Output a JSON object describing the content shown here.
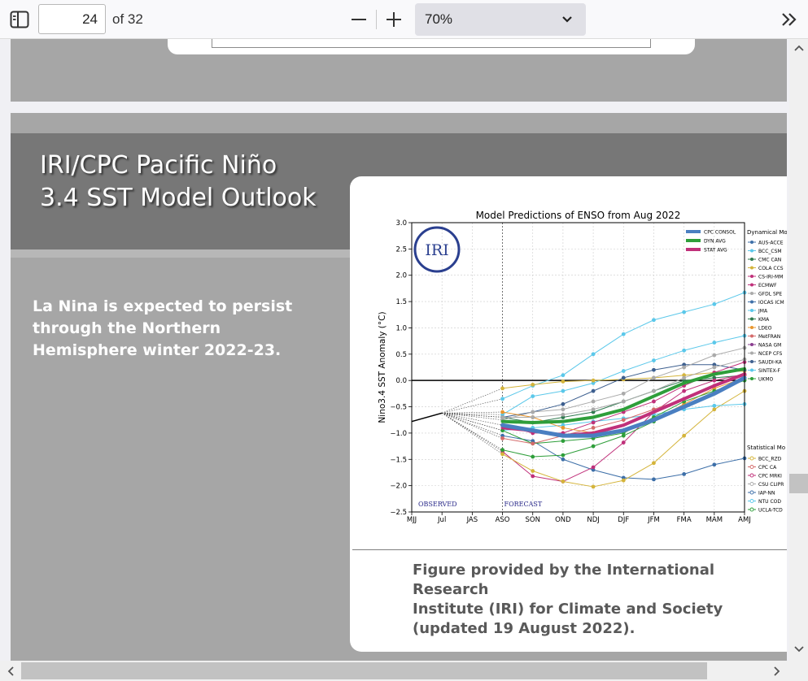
{
  "toolbar": {
    "page_number": "24",
    "page_count_label": "of 32",
    "zoom_value": "70%"
  },
  "slide": {
    "title_line1": "IRI/CPC Pacific Niño",
    "title_line2": "3.4 SST Model Outlook",
    "body_text": "La Nina is expected to persist through the Northern Hemisphere winter 2022-23.",
    "caption_line1": "Figure provided by the International Research",
    "caption_line2": "Institute (IRI) for Climate and Society",
    "caption_line3": "(updated 19 August 2022)."
  },
  "colors": {
    "cpc_consol": "#4a7fc1",
    "dyn_avg": "#2e9e3a",
    "stat_avg": "#c0307a"
  },
  "chart_data": {
    "type": "line",
    "title": "Model Predictions of ENSO from Aug 2022",
    "ylabel": "Nino3.4 SST Anomaly (°C)",
    "xlabel": "",
    "categories": [
      "MJJ",
      "Jul",
      "JAS",
      "ASO",
      "SON",
      "OND",
      "NDJ",
      "DJF",
      "JFM",
      "FMA",
      "MAM",
      "AMJ"
    ],
    "ylim": [
      -2.5,
      3.0
    ],
    "yticks": [
      "−2.5",
      "−2.0",
      "−1.5",
      "−1.0",
      "−0.5",
      "0.0",
      "0.5",
      "1.0",
      "1.5",
      "2.0",
      "2.5",
      "3.0"
    ],
    "ytick_values": [
      -2.5,
      -2.0,
      -1.5,
      -1.0,
      -0.5,
      0.0,
      0.5,
      1.0,
      1.5,
      2.0,
      2.5,
      3.0
    ],
    "grid": true,
    "observed_label": "OBSERVED",
    "forecast_label": "FORECAST",
    "logo_text": "IRI",
    "observed": [
      -0.78,
      -0.62
    ],
    "legend_main": [
      "CPC CONSOL",
      "DYN AVG",
      "STAT AVG"
    ],
    "dynamical_header": "Dynamical Mo",
    "dynamical_models": [
      "AUS-ACCE",
      "BCC_CSM",
      "CMC CAN",
      "COLA CCS",
      "CS-IRI-MM",
      "ECMWF",
      "GFDL SPE",
      "IOCAS ICM",
      "JMA",
      "KMA",
      "LDEO",
      "MetFRAN",
      "NASA GM",
      "NCEP CFS",
      "SAUDI-KA",
      "SINTEX-F",
      "UKMO"
    ],
    "statistical_header": "Statistical Mo",
    "statistical_models": [
      "BCC_RZD",
      "CPC CA",
      "CPC MRKI",
      "CSU CLIPR",
      "IAP-NN",
      "NTU COD",
      "UCLA-TCD"
    ],
    "series": [
      {
        "name": "CPC CONSOL",
        "color": "#4a7fc1",
        "width": 5,
        "start": 3,
        "values": [
          -0.85,
          -0.95,
          -1.05,
          -1.05,
          -0.95,
          -0.75,
          -0.5,
          -0.25,
          0.05
        ]
      },
      {
        "name": "DYN AVG",
        "color": "#2e9e3a",
        "width": 4,
        "start": 3,
        "values": [
          -0.78,
          -0.8,
          -0.78,
          -0.7,
          -0.55,
          -0.3,
          -0.05,
          0.12,
          0.22
        ]
      },
      {
        "name": "STAT AVG",
        "color": "#c0307a",
        "width": 4,
        "start": 3,
        "values": [
          -0.9,
          -0.95,
          -1.05,
          -1.0,
          -0.85,
          -0.6,
          -0.35,
          -0.1,
          0.12
        ]
      },
      {
        "name": "JMA",
        "color": "#5bc8ea",
        "width": 1,
        "start": 3,
        "values": [
          -0.35,
          -0.1,
          0.1,
          0.5,
          0.88,
          1.15,
          1.3,
          1.45,
          1.67
        ]
      },
      {
        "name": "BCC_CSM",
        "color": "#5bc8ea",
        "width": 1,
        "start": 3,
        "values": [
          -0.65,
          -0.3,
          -0.2,
          -0.05,
          0.18,
          0.38,
          0.57,
          0.72,
          0.85
        ]
      },
      {
        "name": "COLA CCSM",
        "color": "#d4b43a",
        "width": 1,
        "start": 3,
        "values": [
          -0.15,
          -0.08,
          -0.02,
          0.0,
          0.02,
          0.05,
          0.1,
          0.15,
          0.18
        ]
      },
      {
        "name": "SAUDI-KAU",
        "color": "#3d5f8f",
        "width": 1,
        "start": 3,
        "values": [
          -0.7,
          -0.6,
          -0.45,
          -0.2,
          0.05,
          0.2,
          0.3,
          0.3,
          0.2
        ]
      },
      {
        "name": "CMC CANSIP",
        "color": "#2f7a4f",
        "width": 1,
        "start": 3,
        "values": [
          -0.7,
          -0.8,
          -0.7,
          -0.6,
          -0.4,
          -0.2,
          0.0,
          0.05,
          0.1
        ]
      },
      {
        "name": "IOCAS ICM",
        "color": "#3d6fa8",
        "width": 1,
        "start": 3,
        "values": [
          -1.05,
          -1.15,
          -1.5,
          -1.7,
          -1.85,
          -1.88,
          -1.78,
          -1.6,
          -1.48
        ]
      },
      {
        "name": "ECMWF",
        "color": "#c0307a",
        "width": 1,
        "start": 3,
        "values": [
          -1.35,
          -1.82,
          -1.92,
          -1.65,
          -1.18,
          -0.6,
          -0.2,
          0.0,
          0.12
        ]
      },
      {
        "name": "BCC_RZDM",
        "color": "#d4b43a",
        "width": 1,
        "start": 3,
        "values": [
          -1.4,
          -1.72,
          -1.92,
          -2.02,
          -1.9,
          -1.57,
          -1.05,
          -0.55,
          -0.2
        ]
      },
      {
        "name": "UKMO",
        "color": "#2e9e3a",
        "width": 1,
        "start": 3,
        "values": [
          -1.32,
          -1.45,
          -1.42,
          -1.25,
          -1.05,
          -0.78,
          -0.5,
          -0.25,
          0.02
        ]
      },
      {
        "name": "NTU CODA",
        "color": "#5bc8ea",
        "width": 1,
        "start": 3,
        "values": [
          -0.95,
          -0.9,
          -0.85,
          -0.78,
          -0.72,
          -0.65,
          -0.55,
          -0.48,
          -0.45
        ]
      },
      {
        "name": "NCEP CFSv2",
        "color": "#aaaaaa",
        "width": 1,
        "start": 3,
        "values": [
          -0.75,
          -0.6,
          -0.55,
          -0.4,
          -0.25,
          0.05,
          0.25,
          0.48,
          0.62
        ]
      },
      {
        "name": "CPC MRKOV",
        "color": "#c0307a",
        "width": 1,
        "start": 3,
        "values": [
          -0.85,
          -1.0,
          -1.0,
          -0.8,
          -0.6,
          -0.4,
          -0.1,
          0.15,
          0.35
        ]
      },
      {
        "name": "LDEO",
        "color": "#e8962e",
        "width": 1,
        "start": 3,
        "values": [
          -0.6,
          -0.7,
          -0.9,
          -1.0,
          -0.95,
          -0.75,
          -0.45,
          -0.15,
          0.05
        ]
      },
      {
        "name": "UCLA-TCD",
        "color": "#2e9e3a",
        "width": 1,
        "start": 3,
        "values": [
          -0.95,
          -1.2,
          -1.15,
          -1.1,
          -1.0,
          -0.7,
          -0.4,
          -0.2,
          0.0
        ]
      },
      {
        "name": "CPC CA",
        "color": "#d46a6a",
        "width": 1,
        "start": 3,
        "values": [
          -1.1,
          -1.2,
          -1.05,
          -0.9,
          -0.75,
          -0.55,
          -0.35,
          -0.1,
          0.1
        ]
      },
      {
        "name": "CSU CLIPR",
        "color": "#aaaaaa",
        "width": 1,
        "start": 3,
        "values": [
          -0.7,
          -0.7,
          -0.65,
          -0.55,
          -0.4,
          -0.2,
          0.05,
          0.25,
          0.4
        ]
      }
    ]
  }
}
